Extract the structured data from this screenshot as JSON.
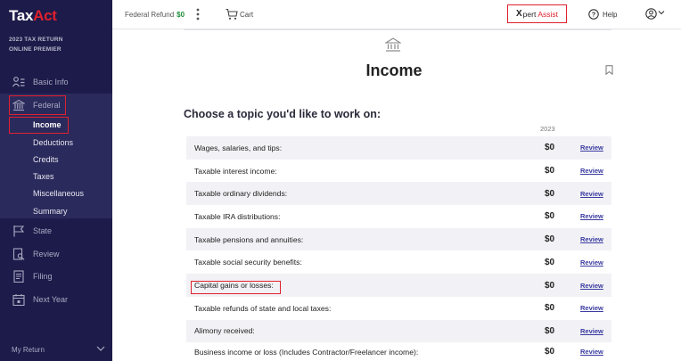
{
  "sidebar": {
    "logo_main": "Tax",
    "logo_accent": "Act",
    "year_line1": "2023 TAX RETURN",
    "year_line2": "ONLINE PREMIER",
    "items": {
      "basic_info": "Basic Info",
      "federal": "Federal",
      "state": "State",
      "review": "Review",
      "filing": "Filing",
      "next_year": "Next Year"
    },
    "federal_sub": [
      "Income",
      "Deductions",
      "Credits",
      "Taxes",
      "Miscellaneous",
      "Summary"
    ],
    "my_return": "My Return"
  },
  "topbar": {
    "refund_label": "Federal Refund",
    "refund_amount": "$0",
    "cart_label": "Cart",
    "xpert_x": "X",
    "xpert_pert": "pert",
    "xpert_assist": "Assist",
    "help_label": "Help"
  },
  "main": {
    "title": "Income",
    "heading": "Choose a topic you'd like to work on:",
    "year_column": "2023",
    "rows": [
      {
        "label": "Wages, salaries, and tips:",
        "amount": "$0",
        "action": "Review"
      },
      {
        "label": "Taxable interest income:",
        "amount": "$0",
        "action": "Review"
      },
      {
        "label": "Taxable ordinary dividends:",
        "amount": "$0",
        "action": "Review"
      },
      {
        "label": "Taxable IRA distributions:",
        "amount": "$0",
        "action": "Review"
      },
      {
        "label": "Taxable pensions and annuities:",
        "amount": "$0",
        "action": "Review"
      },
      {
        "label": "Taxable social security benefits:",
        "amount": "$0",
        "action": "Review"
      },
      {
        "label": "Capital gains or losses:",
        "amount": "$0",
        "action": "Review"
      },
      {
        "label": "Taxable refunds of state and local taxes:",
        "amount": "$0",
        "action": "Review"
      },
      {
        "label": "Alimony received:",
        "amount": "$0",
        "action": "Review"
      },
      {
        "label": "Business income or loss (Includes Contractor/Freelancer income):",
        "amount": "$0",
        "action": "Review"
      }
    ]
  },
  "colors": {
    "sidebar_bg": "#1c1b4a",
    "sidebar_active": "#2b2a5c",
    "accent_red": "#e0202e",
    "refund_green": "#1e8f3a",
    "link_blue": "#3a3aa0"
  }
}
